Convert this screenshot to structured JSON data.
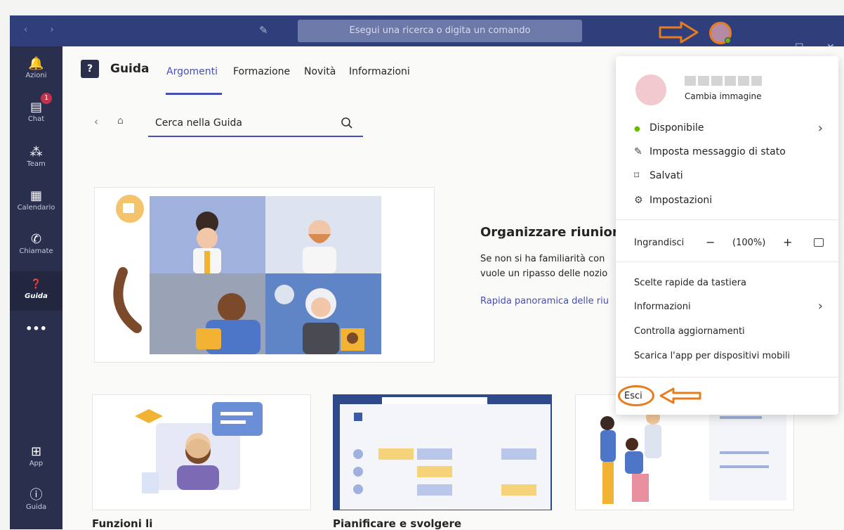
{
  "topbar": {
    "search_placeholder": "Esegui una ricerca o digita un comando"
  },
  "rail": {
    "items": [
      {
        "label": "Azioni",
        "icon": "bell-icon"
      },
      {
        "label": "Chat",
        "icon": "chat-icon",
        "badge": "1"
      },
      {
        "label": "Team",
        "icon": "team-icon"
      },
      {
        "label": "Calendario",
        "icon": "calendar-icon"
      },
      {
        "label": "Chiamate",
        "icon": "phone-icon"
      },
      {
        "label": "Guida",
        "icon": "help-icon"
      },
      {
        "label": "•••",
        "icon": "more-icon"
      },
      {
        "label": "App",
        "icon": "apps-icon"
      },
      {
        "label": "Guida",
        "icon": "help-circle-icon"
      }
    ]
  },
  "header": {
    "title": "Guida",
    "tabs": [
      "Argomenti",
      "Formazione",
      "Novità",
      "Informazioni"
    ]
  },
  "search": {
    "placeholder": "Cerca nella Guida"
  },
  "hero": {
    "title": "Organizzare riunioni",
    "body_line1": "Se non si ha familiarità con",
    "body_line2": "vuole un ripasso delle nozio",
    "link": "Rapida panoramica delle riu"
  },
  "cards": [
    {
      "caption": "Funzioni li"
    },
    {
      "caption": "Pianificare e svolgere"
    },
    {
      "caption": ""
    }
  ],
  "menu": {
    "change_picture": "Cambia immagine",
    "status": "Disponibile",
    "set_status": "Imposta messaggio di stato",
    "saved": "Salvati",
    "settings": "Impostazioni",
    "zoom_label": "Ingrandisci",
    "zoom_minus": "−",
    "zoom_value": "(100%)",
    "zoom_plus": "+",
    "shortcuts": "Scelte rapide da tastiera",
    "info": "Informazioni",
    "check_updates": "Controlla aggiornamenti",
    "mobile_app": "Scarica l'app per dispositivi mobili",
    "sign_out": "Esci"
  },
  "colors": {
    "topbar": "#2f3f7c",
    "rail": "#2b2f4e",
    "accent": "#464eb8",
    "annotation": "#e87b1c",
    "available": "#6bb700"
  }
}
